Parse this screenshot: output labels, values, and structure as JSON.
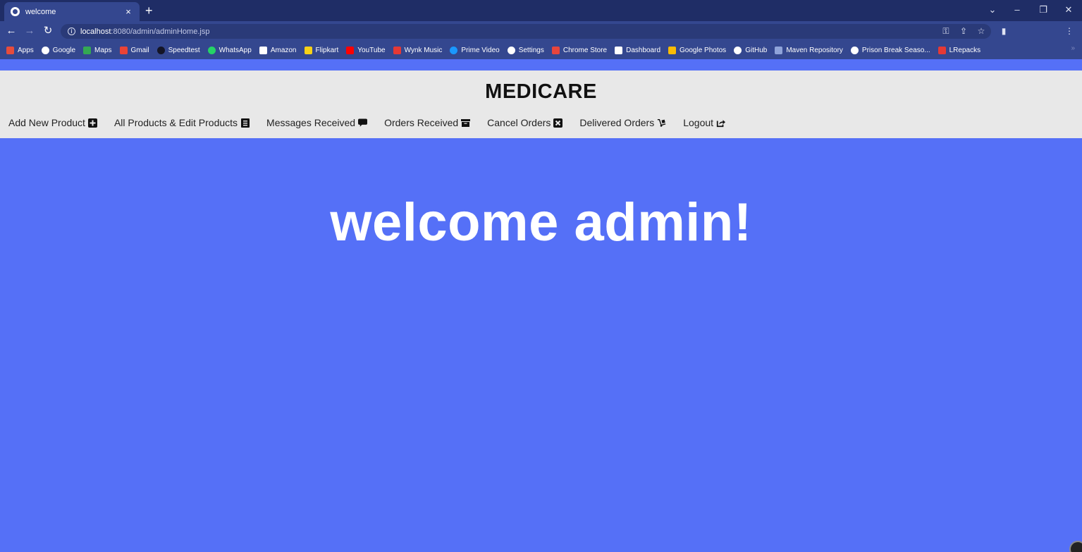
{
  "browser": {
    "tab_title": "welcome",
    "tab_close": "×",
    "new_tab": "+",
    "url_host": "localhost",
    "url_path": ":8080/admin/adminHome.jsp",
    "bookmarks": [
      {
        "label": "Apps",
        "icon": "apps-grid-icon",
        "color": "#e74c3c"
      },
      {
        "label": "Google",
        "icon": "google-icon",
        "color": "#ffffff"
      },
      {
        "label": "Maps",
        "icon": "maps-icon",
        "color": "#34a853"
      },
      {
        "label": "Gmail",
        "icon": "gmail-icon",
        "color": "#ea4335"
      },
      {
        "label": "Speedtest",
        "icon": "speedtest-icon",
        "color": "#141526"
      },
      {
        "label": "WhatsApp",
        "icon": "whatsapp-icon",
        "color": "#25d366"
      },
      {
        "label": "Amazon",
        "icon": "amazon-icon",
        "color": "#ffffff"
      },
      {
        "label": "Flipkart",
        "icon": "flipkart-icon",
        "color": "#f7d117"
      },
      {
        "label": "YouTube",
        "icon": "youtube-icon",
        "color": "#ff0000"
      },
      {
        "label": "Wynk Music",
        "icon": "wynk-icon",
        "color": "#e53935"
      },
      {
        "label": "Prime Video",
        "icon": "prime-video-icon",
        "color": "#1a98ff"
      },
      {
        "label": "Settings",
        "icon": "gear-icon",
        "color": "#ffffff"
      },
      {
        "label": "Chrome Store",
        "icon": "chrome-store-icon",
        "color": "#e8453c"
      },
      {
        "label": "Dashboard",
        "icon": "dashboard-icon",
        "color": "#ffffff"
      },
      {
        "label": "Google Photos",
        "icon": "google-photos-icon",
        "color": "#fbbc04"
      },
      {
        "label": "GitHub",
        "icon": "github-icon",
        "color": "#ffffff"
      },
      {
        "label": "Maven Repository",
        "icon": "maven-icon",
        "color": "#8fa3d9"
      },
      {
        "label": "Prison Break Seaso...",
        "icon": "wordpress-icon",
        "color": "#ffffff"
      },
      {
        "label": "LRepacks",
        "icon": "lrepacks-icon",
        "color": "#e53935"
      }
    ],
    "bookmarks_more": "»"
  },
  "header": {
    "brand": "MEDICARE",
    "menu": [
      {
        "label": "Add New Product",
        "icon": "plus-square-icon"
      },
      {
        "label": "All Products & Edit Products",
        "icon": "list-icon"
      },
      {
        "label": "Messages Received",
        "icon": "comment-icon"
      },
      {
        "label": "Orders Received",
        "icon": "archive-icon"
      },
      {
        "label": "Cancel Orders",
        "icon": "close-square-icon"
      },
      {
        "label": "Delivered Orders",
        "icon": "dolly-icon"
      },
      {
        "label": "Logout",
        "icon": "share-square-icon"
      }
    ]
  },
  "main": {
    "welcome_text": "welcome admin!"
  },
  "colors": {
    "page_background": "#5570f7",
    "header_background": "#e8e8e8",
    "chrome_tabstrip": "#1f2d66",
    "chrome_toolbar": "#34478f"
  }
}
